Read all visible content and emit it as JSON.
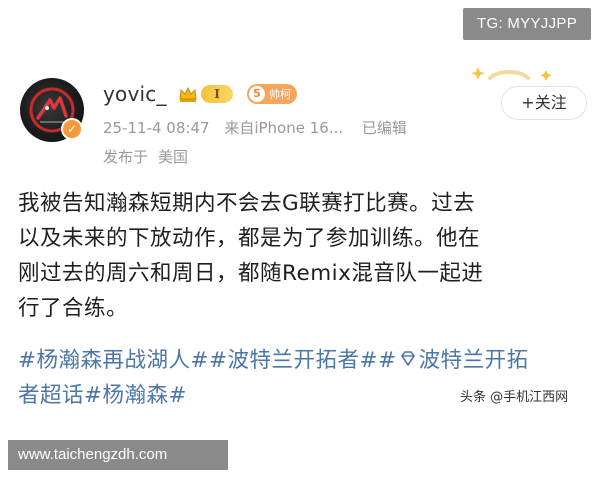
{
  "watermarks": {
    "telegram": "TG: MYYJJPP",
    "url": "www.taichengzdh.com",
    "source": "头条 @手机江西网"
  },
  "post": {
    "author": {
      "username": "yovic_",
      "level": "I",
      "fan_level": "5",
      "fan_label": "帅柯",
      "avatar_icon": "team-logo-avatar"
    },
    "meta": {
      "date": "25-11-4 08:47",
      "source": "来自iPhone 16...",
      "edited": "已编辑",
      "published_prefix": "发布于",
      "location": "美国"
    },
    "follow_label": "+关注",
    "body_lines": [
      "我被告知瀚森短期内不会去G联赛打比赛。过去",
      "以及未来的下放动作，都是为了参加训练。他在",
      "刚过去的周六和周日，都随Remix混音队一起进",
      "行了合练。"
    ],
    "topics": {
      "tag1": "#杨瀚森再战湖人#",
      "tag2": "#波特兰开拓者#",
      "tag3_line1": "波特兰开拓",
      "tag3_line2": "者超话",
      "tag4": "#杨瀚森#"
    }
  },
  "colors": {
    "topic": "#4a76a8",
    "meta": "#999999",
    "verified": "#f29b38",
    "watermark_bg": "#8a8a8a"
  }
}
